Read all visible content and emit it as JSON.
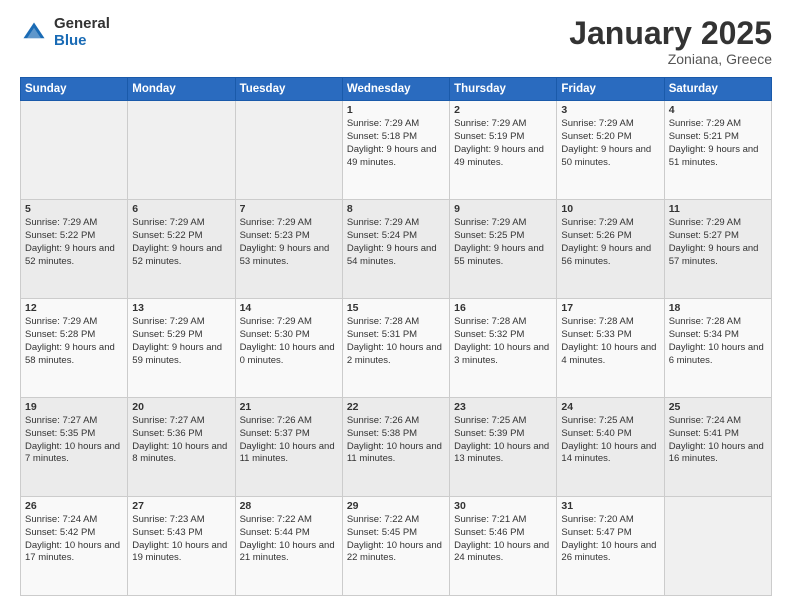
{
  "logo": {
    "general": "General",
    "blue": "Blue"
  },
  "header": {
    "title": "January 2025",
    "subtitle": "Zoniana, Greece"
  },
  "weekdays": [
    "Sunday",
    "Monday",
    "Tuesday",
    "Wednesday",
    "Thursday",
    "Friday",
    "Saturday"
  ],
  "weeks": [
    [
      {
        "day": "",
        "info": ""
      },
      {
        "day": "",
        "info": ""
      },
      {
        "day": "",
        "info": ""
      },
      {
        "day": "1",
        "info": "Sunrise: 7:29 AM\nSunset: 5:18 PM\nDaylight: 9 hours and 49 minutes."
      },
      {
        "day": "2",
        "info": "Sunrise: 7:29 AM\nSunset: 5:19 PM\nDaylight: 9 hours and 49 minutes."
      },
      {
        "day": "3",
        "info": "Sunrise: 7:29 AM\nSunset: 5:20 PM\nDaylight: 9 hours and 50 minutes."
      },
      {
        "day": "4",
        "info": "Sunrise: 7:29 AM\nSunset: 5:21 PM\nDaylight: 9 hours and 51 minutes."
      }
    ],
    [
      {
        "day": "5",
        "info": "Sunrise: 7:29 AM\nSunset: 5:22 PM\nDaylight: 9 hours and 52 minutes."
      },
      {
        "day": "6",
        "info": "Sunrise: 7:29 AM\nSunset: 5:22 PM\nDaylight: 9 hours and 52 minutes."
      },
      {
        "day": "7",
        "info": "Sunrise: 7:29 AM\nSunset: 5:23 PM\nDaylight: 9 hours and 53 minutes."
      },
      {
        "day": "8",
        "info": "Sunrise: 7:29 AM\nSunset: 5:24 PM\nDaylight: 9 hours and 54 minutes."
      },
      {
        "day": "9",
        "info": "Sunrise: 7:29 AM\nSunset: 5:25 PM\nDaylight: 9 hours and 55 minutes."
      },
      {
        "day": "10",
        "info": "Sunrise: 7:29 AM\nSunset: 5:26 PM\nDaylight: 9 hours and 56 minutes."
      },
      {
        "day": "11",
        "info": "Sunrise: 7:29 AM\nSunset: 5:27 PM\nDaylight: 9 hours and 57 minutes."
      }
    ],
    [
      {
        "day": "12",
        "info": "Sunrise: 7:29 AM\nSunset: 5:28 PM\nDaylight: 9 hours and 58 minutes."
      },
      {
        "day": "13",
        "info": "Sunrise: 7:29 AM\nSunset: 5:29 PM\nDaylight: 9 hours and 59 minutes."
      },
      {
        "day": "14",
        "info": "Sunrise: 7:29 AM\nSunset: 5:30 PM\nDaylight: 10 hours and 0 minutes."
      },
      {
        "day": "15",
        "info": "Sunrise: 7:28 AM\nSunset: 5:31 PM\nDaylight: 10 hours and 2 minutes."
      },
      {
        "day": "16",
        "info": "Sunrise: 7:28 AM\nSunset: 5:32 PM\nDaylight: 10 hours and 3 minutes."
      },
      {
        "day": "17",
        "info": "Sunrise: 7:28 AM\nSunset: 5:33 PM\nDaylight: 10 hours and 4 minutes."
      },
      {
        "day": "18",
        "info": "Sunrise: 7:28 AM\nSunset: 5:34 PM\nDaylight: 10 hours and 6 minutes."
      }
    ],
    [
      {
        "day": "19",
        "info": "Sunrise: 7:27 AM\nSunset: 5:35 PM\nDaylight: 10 hours and 7 minutes."
      },
      {
        "day": "20",
        "info": "Sunrise: 7:27 AM\nSunset: 5:36 PM\nDaylight: 10 hours and 8 minutes."
      },
      {
        "day": "21",
        "info": "Sunrise: 7:26 AM\nSunset: 5:37 PM\nDaylight: 10 hours and 11 minutes."
      },
      {
        "day": "22",
        "info": "Sunrise: 7:26 AM\nSunset: 5:38 PM\nDaylight: 10 hours and 11 minutes."
      },
      {
        "day": "23",
        "info": "Sunrise: 7:25 AM\nSunset: 5:39 PM\nDaylight: 10 hours and 13 minutes."
      },
      {
        "day": "24",
        "info": "Sunrise: 7:25 AM\nSunset: 5:40 PM\nDaylight: 10 hours and 14 minutes."
      },
      {
        "day": "25",
        "info": "Sunrise: 7:24 AM\nSunset: 5:41 PM\nDaylight: 10 hours and 16 minutes."
      }
    ],
    [
      {
        "day": "26",
        "info": "Sunrise: 7:24 AM\nSunset: 5:42 PM\nDaylight: 10 hours and 17 minutes."
      },
      {
        "day": "27",
        "info": "Sunrise: 7:23 AM\nSunset: 5:43 PM\nDaylight: 10 hours and 19 minutes."
      },
      {
        "day": "28",
        "info": "Sunrise: 7:22 AM\nSunset: 5:44 PM\nDaylight: 10 hours and 21 minutes."
      },
      {
        "day": "29",
        "info": "Sunrise: 7:22 AM\nSunset: 5:45 PM\nDaylight: 10 hours and 22 minutes."
      },
      {
        "day": "30",
        "info": "Sunrise: 7:21 AM\nSunset: 5:46 PM\nDaylight: 10 hours and 24 minutes."
      },
      {
        "day": "31",
        "info": "Sunrise: 7:20 AM\nSunset: 5:47 PM\nDaylight: 10 hours and 26 minutes."
      },
      {
        "day": "",
        "info": ""
      }
    ]
  ]
}
